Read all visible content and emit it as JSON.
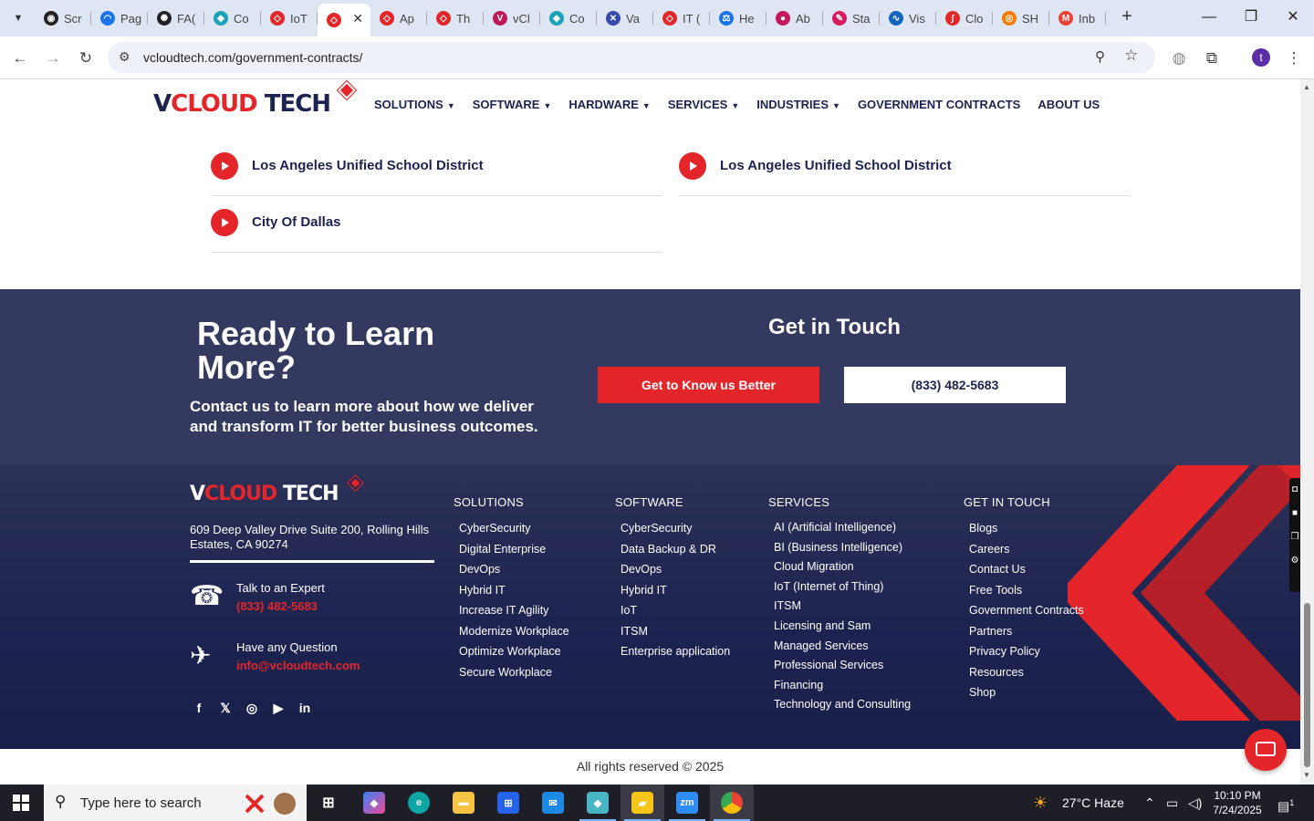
{
  "browser": {
    "tabs": [
      {
        "label": "Scr",
        "color": "#202124",
        "glyph": "◉"
      },
      {
        "label": "Pag",
        "color": "#1a73e8",
        "glyph": "◠"
      },
      {
        "label": "FA(",
        "color": "#202124",
        "glyph": "✺"
      },
      {
        "label": "Co",
        "color": "#1aa3b8",
        "glyph": "◆"
      },
      {
        "label": "IoT",
        "color": "#e4262a",
        "glyph": "◇"
      },
      {
        "label": "",
        "color": "#e4262a",
        "glyph": "◇",
        "active": true
      },
      {
        "label": "Ap",
        "color": "#e4262a",
        "glyph": "◇"
      },
      {
        "label": "Th",
        "color": "#e4262a",
        "glyph": "◇"
      },
      {
        "label": "vCl",
        "color": "#c2185b",
        "glyph": "V"
      },
      {
        "label": "Co",
        "color": "#1aa3b8",
        "glyph": "◆"
      },
      {
        "label": "Va",
        "color": "#3949ab",
        "glyph": "✕"
      },
      {
        "label": "IT (",
        "color": "#e4262a",
        "glyph": "◇"
      },
      {
        "label": "He",
        "color": "#1a73e8",
        "glyph": "⚖"
      },
      {
        "label": "Ab",
        "color": "#c2185b",
        "glyph": "●"
      },
      {
        "label": "Sta",
        "color": "#d81b60",
        "glyph": "✎"
      },
      {
        "label": "Vis",
        "color": "#1565c0",
        "glyph": "∿"
      },
      {
        "label": "Clo",
        "color": "#e4262a",
        "glyph": "∫"
      },
      {
        "label": "SH",
        "color": "#f57c00",
        "glyph": "◎"
      },
      {
        "label": "Inb",
        "color": "#ea4335",
        "glyph": "M"
      }
    ],
    "active_close": "✕",
    "new_tab": "+",
    "url": "vcloudtech.com/government-contracts/",
    "profile_initial": "t"
  },
  "logo": {
    "v": "V",
    "cloud": "CLOUD",
    "tech": " TECH"
  },
  "nav": [
    {
      "label": "SOLUTIONS",
      "caret": true
    },
    {
      "label": "SOFTWARE",
      "caret": true
    },
    {
      "label": "HARDWARE",
      "caret": true
    },
    {
      "label": "SERVICES",
      "caret": true
    },
    {
      "label": "INDUSTRIES",
      "caret": true
    },
    {
      "label": "GOVERNMENT CONTRACTS",
      "caret": false
    },
    {
      "label": "ABOUT US",
      "caret": false
    }
  ],
  "clients": [
    "Los Angeles Unified School District",
    "Los Angeles Unified School District",
    "City Of Dallas"
  ],
  "cta": {
    "heading": "Ready to Learn More?",
    "sub": "Contact us to learn more about how we deliver and transform IT for better business outcomes.",
    "get_in_touch": "Get in Touch",
    "btn_primary": "Get to Know us Better",
    "btn_phone": "(833) 482-5683"
  },
  "footer": {
    "address": "609 Deep Valley Drive Suite 200, Rolling Hills Estates, CA 90274",
    "talk_label": "Talk to an Expert",
    "talk_value": "(833) 482-5683",
    "question_label": "Have any Question",
    "question_value": "info@vcloudtech.com",
    "columns": [
      {
        "title": "SOLUTIONS",
        "items": [
          "CyberSecurity",
          "Digital Enterprise",
          "DevOps",
          "Hybrid IT",
          "Increase IT Agility",
          "Modernize Workplace",
          "Optimize Workplace",
          "Secure Workplace"
        ]
      },
      {
        "title": "SOFTWARE",
        "items": [
          "CyberSecurity",
          "Data Backup & DR",
          "DevOps",
          "Hybrid IT",
          "IoT",
          "ITSM",
          "Enterprise application"
        ]
      },
      {
        "title": "SERVICES",
        "items": [
          "AI (Artificial Intelligence)",
          "BI (Business Intelligence)",
          "Cloud Migration",
          "IoT (Internet of Thing)",
          "ITSM",
          "Licensing and Sam",
          "Managed Services",
          "Professional Services",
          "Financing",
          "Technology and Consulting"
        ]
      },
      {
        "title": "GET IN TOUCH",
        "items": [
          "Blogs",
          "Careers",
          "Contact Us",
          "Free Tools",
          "Government Contracts",
          "Partners",
          "Privacy Policy",
          "Resources",
          "Shop"
        ]
      }
    ],
    "copyright": "All rights reserved © 2025"
  },
  "taskbar": {
    "search_placeholder": "Type here to search",
    "weather": "27°C  Haze",
    "time": "10:10 PM",
    "date": "7/24/2025",
    "notif_count": "1"
  },
  "colors": {
    "brand_red": "#e4262a",
    "brand_navy": "#1c2350",
    "cta_bg": "#343a5f"
  }
}
